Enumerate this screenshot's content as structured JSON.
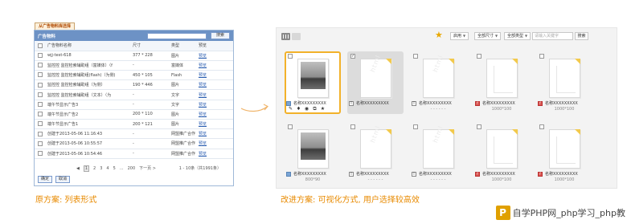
{
  "left": {
    "tab_label": "从广告物料库选择",
    "header_title": "广告物料",
    "search_value": "",
    "search_button": "搜索",
    "columns": [
      "",
      "广告物料名称",
      "尺寸",
      "类型",
      "预览"
    ],
    "rows": [
      {
        "name": "wjj-test-618",
        "size": "377 * 228",
        "type": "图片",
        "preview": "预览"
      },
      {
        "name": "监控控 监控检索辅助组（富媒体）（f",
        "size": "-",
        "type": "富媒体",
        "preview": "预览"
      },
      {
        "name": "监控控 监控检索辅助组(flash)（为侧)",
        "size": "450 * 105",
        "type": "Flash",
        "preview": "预览"
      },
      {
        "name": "监控控 监控检索辅助组（为侧）",
        "size": "190 * 446",
        "type": "图片",
        "preview": "预览"
      },
      {
        "name": "监控控 监控检索辅助组（文本）（为",
        "size": "-",
        "type": "文字",
        "preview": "预览"
      },
      {
        "name": "端午节显示广告3",
        "size": "-",
        "type": "文字",
        "preview": "预览"
      },
      {
        "name": "端午节显示广告2",
        "size": "200 * 110",
        "type": "图片",
        "preview": "预览"
      },
      {
        "name": "端午节显示广告1",
        "size": "200 * 121",
        "type": "图片",
        "preview": "预览"
      },
      {
        "name": "创建于2013-05-06 11:16:43",
        "size": "-",
        "type": "网盟推广合作",
        "preview": "预览"
      },
      {
        "name": "创建于2013-05-06 10:55:57",
        "size": "-",
        "type": "网盟推广合作",
        "preview": "预览"
      },
      {
        "name": "创建于2013-05-06 10:54:46",
        "size": "-",
        "type": "网盟推广合作",
        "preview": "预览"
      }
    ],
    "pager": {
      "pages": [
        "1",
        "2",
        "3",
        "4",
        "5",
        "...",
        "200"
      ],
      "next": "下一页 >",
      "info": "1 - 10条（共1991条）"
    },
    "confirm_button": "确定",
    "cancel_button": "取消"
  },
  "right": {
    "toolbar": {
      "dd1": "启用",
      "dd2": "全部尺寸",
      "dd3": "全部类型",
      "keyword_placeholder": "请输入关键字",
      "search_button": "搜索"
    },
    "items": [
      {
        "name": "名称XXXXXXXXX",
        "sub": "",
        "type": "img",
        "thumb": "photo",
        "checked": false,
        "selected": true
      },
      {
        "name": "名称XXXXXXXXX",
        "sub": "",
        "type": "text",
        "thumb": "html",
        "checked": true,
        "selected": false
      },
      {
        "name": "名称XXXXXXXXX",
        "sub": "- - - - - -",
        "type": "text",
        "thumb": "html",
        "checked": false,
        "selected": false
      },
      {
        "name": "名称XXXXXXXXX",
        "sub": "1000*100",
        "type": "flash",
        "thumb": "chart",
        "checked": false,
        "selected": false
      },
      {
        "name": "名称XXXXXXXXX",
        "sub": "1000*100",
        "type": "flash",
        "thumb": "chart",
        "checked": false,
        "selected": false
      },
      {
        "name": "名称XXXXXXXXX",
        "sub": "800*90",
        "type": "img",
        "thumb": "photo",
        "checked": false,
        "selected": false
      },
      {
        "name": "名称XXXXXXXXX",
        "sub": "- - - - - -",
        "type": "text",
        "thumb": "html",
        "checked": false,
        "selected": false
      },
      {
        "name": "名称XXXXXXXXX",
        "sub": "- - - - - -",
        "type": "text",
        "thumb": "html",
        "checked": false,
        "selected": false
      },
      {
        "name": "名称XXXXXXXXX",
        "sub": "1000*100",
        "type": "flash",
        "thumb": "chart",
        "checked": false,
        "selected": false
      },
      {
        "name": "名称XXXXXXXXX",
        "sub": "1000*100",
        "type": "flash",
        "thumb": "chart",
        "checked": false,
        "selected": false
      }
    ],
    "item_tools": [
      "✎",
      "♦",
      "◉",
      "⧉",
      "★"
    ],
    "thumb_html_text": "html"
  },
  "captions": {
    "left": "原方案: 列表形式",
    "right": "改进方案: 可视化方式, 用户选择较高效"
  },
  "watermark": {
    "logo": "P",
    "text": "自学PHP网_php学习_php教"
  },
  "colors": {
    "accent": "#f2b12a",
    "header_blue": "#6d92c5",
    "caption_orange": "#e88a00"
  }
}
